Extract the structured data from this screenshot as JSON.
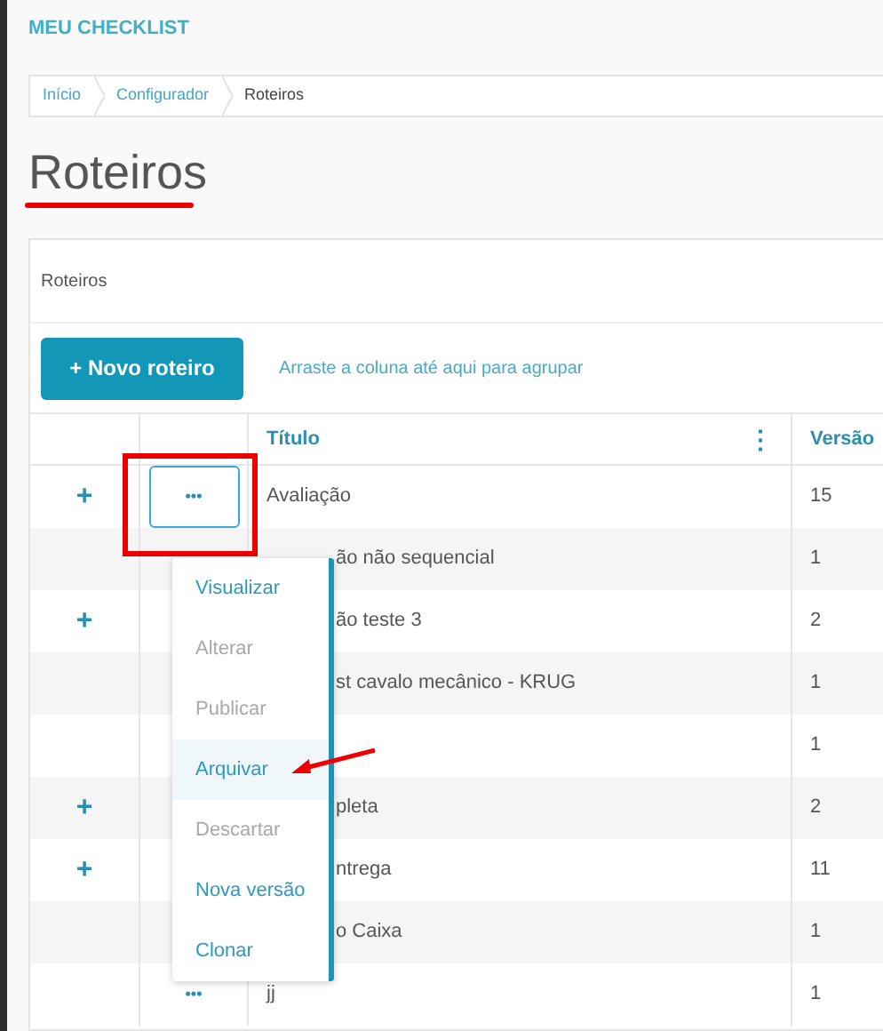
{
  "app_title": "MEU CHECKLIST",
  "breadcrumb": [
    {
      "label": "Início",
      "current": false
    },
    {
      "label": "Configurador",
      "current": false
    },
    {
      "label": "Roteiros",
      "current": true
    }
  ],
  "page_title": "Roteiros",
  "card_title": "Roteiros",
  "new_button": "+ Novo roteiro",
  "group_hint": "Arraste a coluna até aqui para agrupar",
  "table": {
    "columns": [
      {
        "label": "Título"
      },
      {
        "label": "Versão"
      }
    ],
    "rows": [
      {
        "expandable": true,
        "actions": "•••",
        "actions_open": true,
        "title": "Avaliação",
        "title_covered": false,
        "version": "15"
      },
      {
        "expandable": false,
        "title": "ão não sequencial",
        "title_covered": true,
        "version": "1"
      },
      {
        "expandable": true,
        "title": "ão teste 3",
        "title_covered": true,
        "version": "2"
      },
      {
        "expandable": false,
        "title": "st cavalo mecânico - KRUG",
        "title_covered": true,
        "version": "1"
      },
      {
        "expandable": false,
        "version": "1"
      },
      {
        "expandable": true,
        "title": "pleta",
        "title_covered": true,
        "version": "2"
      },
      {
        "expandable": true,
        "title": "ntrega",
        "title_covered": true,
        "version": "11"
      },
      {
        "expandable": false,
        "title": "o Caixa",
        "title_covered": true,
        "version": "1"
      },
      {
        "expandable": false,
        "actions": "•••",
        "actions_open": false,
        "title": "jj",
        "title_covered": false,
        "version": "1"
      }
    ]
  },
  "expand_symbol": "+",
  "column_menu_symbol": "⋮",
  "action_menu": [
    {
      "label": "Visualizar",
      "disabled": false,
      "selected": false
    },
    {
      "label": "Alterar",
      "disabled": true,
      "selected": false
    },
    {
      "label": "Publicar",
      "disabled": true,
      "selected": false
    },
    {
      "label": "Arquivar",
      "disabled": false,
      "selected": true
    },
    {
      "label": "Descartar",
      "disabled": true,
      "selected": false
    },
    {
      "label": "Nova versão",
      "disabled": false,
      "selected": false
    },
    {
      "label": "Clonar",
      "disabled": false,
      "selected": false
    }
  ]
}
